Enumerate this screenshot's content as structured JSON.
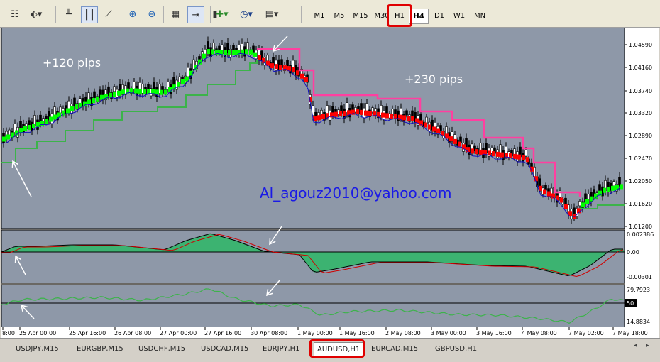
{
  "toolbar": {
    "timeframes": [
      "M1",
      "M5",
      "M15",
      "M30",
      "H1",
      "H4",
      "D1",
      "W1",
      "MN"
    ],
    "active_timeframe": "H4",
    "highlighted_timeframe": "H1",
    "icons": [
      "period-icon",
      "shapes-icon",
      "bar-chart-icon",
      "candlestick-icon",
      "line-chart-icon",
      "zoom-in-icon",
      "zoom-out-icon",
      "tile-icon",
      "autoscroll-icon",
      "add-indicator-icon",
      "clock-icon",
      "template-icon"
    ]
  },
  "chart": {
    "annotations": {
      "left_pips": "+120 pips",
      "right_pips": "+230 pips",
      "email": "Al_agouz2010@yahoo.com"
    },
    "price_axis": [
      "1.04590",
      "1.04160",
      "1.03740",
      "1.03320",
      "1.02890",
      "1.02470",
      "1.02050",
      "1.01620",
      "1.01200"
    ],
    "osc1_axis": [
      "0.002386",
      "0.00",
      "-0.00301"
    ],
    "osc2_axis": [
      "79.7923",
      "50",
      "14.8834"
    ],
    "time_axis": [
      "8:00",
      "25 Apr 00:00",
      "25 Apr 16:00",
      "26 Apr 08:00",
      "27 Apr 00:00",
      "27 Apr 16:00",
      "30 Apr 08:00",
      "1 May 00:00",
      "1 May 16:00",
      "2 May 08:00",
      "3 May 00:00",
      "3 May 16:00",
      "4 May 08:00",
      "7 May 02:00",
      "7 May 18:00"
    ],
    "colors": {
      "background": "#8e98a8",
      "bull_ribbon": "#00ff00",
      "bear_ribbon": "#ff0000",
      "magenta_band": "#ff3fa0",
      "lower_band": "#3cb34a",
      "mid_line": "#1010c0",
      "email_text": "#1a1ae6",
      "histogram": "#3cb371"
    }
  },
  "symbol_tabs": [
    "USDJPY,M15",
    "EURGBP,M15",
    "USDCHF,M15",
    "USDCAD,M15",
    "EURJPY,H1",
    "AUDUSD,H1",
    "EURCAD,M15",
    "GBPUSD,H1"
  ],
  "active_symbol": "AUDUSD,H1"
}
